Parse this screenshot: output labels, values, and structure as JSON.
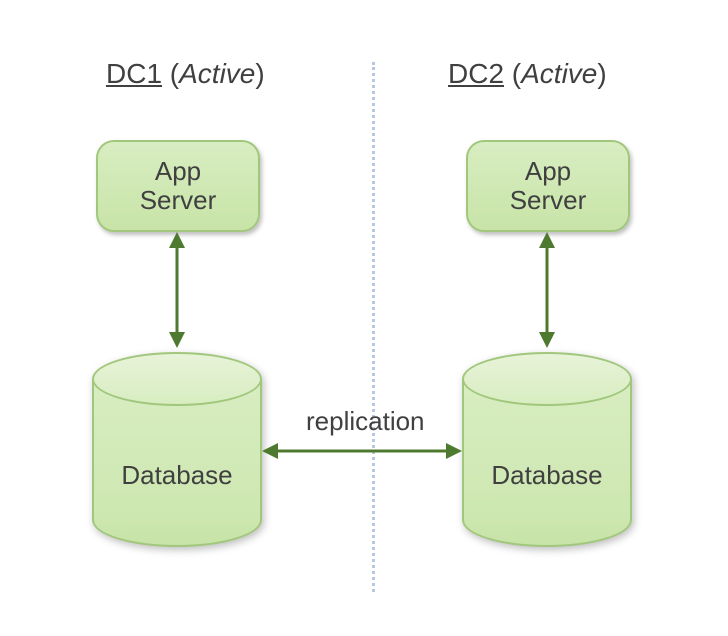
{
  "dc1": {
    "name": "DC1",
    "status": "Active",
    "appServerLabel": "App\nServer",
    "databaseLabel": "Database"
  },
  "dc2": {
    "name": "DC2",
    "status": "Active",
    "appServerLabel": "App\nServer",
    "databaseLabel": "Database"
  },
  "replicationLabel": "replication",
  "colors": {
    "arrow": "#4e7a2f",
    "boxFill": "#d0e8b4",
    "boxBorder": "#a1c77c"
  }
}
